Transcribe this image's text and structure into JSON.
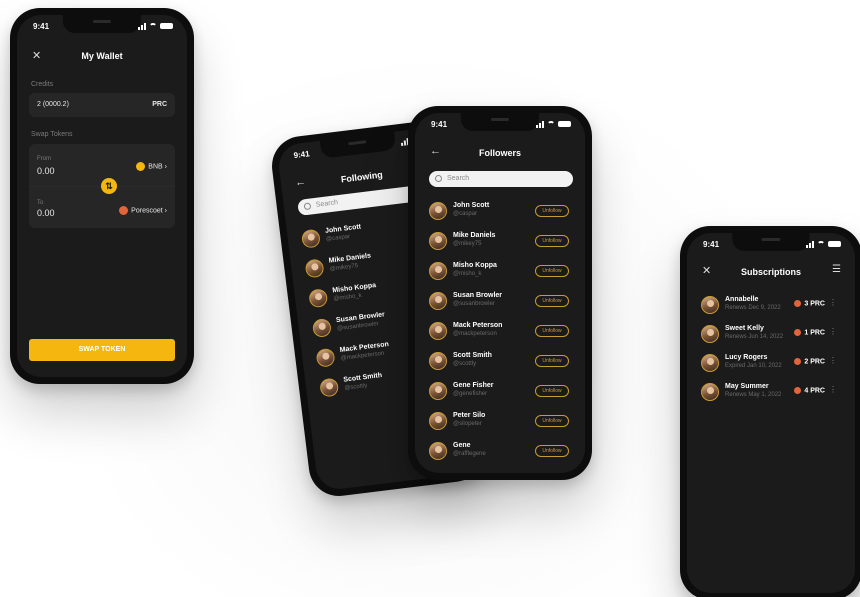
{
  "status_time": "9:41",
  "wallet": {
    "title": "My Wallet",
    "credits_label": "Credits",
    "credits_value": "2 (0000.2)",
    "credits_currency": "PRC",
    "swap_label": "Swap Tokens",
    "from_label": "From",
    "from_amount": "0.00",
    "from_token": "BNB",
    "to_label": "To",
    "to_amount": "0.00",
    "to_token": "Porescoet",
    "swap_button": "SWAP TOKEN"
  },
  "following": {
    "title": "Following",
    "search_placeholder": "Search",
    "items": [
      {
        "name": "John Scott",
        "handle": "@caspar"
      },
      {
        "name": "Mike Daniels",
        "handle": "@mikey75"
      },
      {
        "name": "Misho Koppa",
        "handle": "@misho_k"
      },
      {
        "name": "Susan Browler",
        "handle": "@susanbrowler"
      },
      {
        "name": "Mack Peterson",
        "handle": "@mackpeterson"
      },
      {
        "name": "Scott Smith",
        "handle": "@scottly"
      }
    ]
  },
  "followers": {
    "title": "Followers",
    "search_placeholder": "Search",
    "unfollow_label": "Unfollow",
    "items": [
      {
        "name": "John Scott",
        "handle": "@caspar"
      },
      {
        "name": "Mike Daniels",
        "handle": "@mikey75"
      },
      {
        "name": "Misho Koppa",
        "handle": "@misho_k"
      },
      {
        "name": "Susan Browler",
        "handle": "@susanbrowler"
      },
      {
        "name": "Mack Peterson",
        "handle": "@mackpeterson"
      },
      {
        "name": "Scott Smith",
        "handle": "@scottly"
      },
      {
        "name": "Gene Fisher",
        "handle": "@genefisher"
      },
      {
        "name": "Peter Silo",
        "handle": "@silopeter"
      },
      {
        "name": "Gene",
        "handle": "@rafflegene"
      }
    ]
  },
  "subscriptions": {
    "title": "Subscriptions",
    "items": [
      {
        "name": "Annabelle",
        "note": "Renews Dec 9, 2022",
        "amount": "3 PRC",
        "expired": false
      },
      {
        "name": "Sweet Kelly",
        "note": "Renews Jun 14, 2022",
        "amount": "1 PRC",
        "expired": false
      },
      {
        "name": "Lucy Rogers",
        "note": "Expired Jan 10, 2022",
        "amount": "2 PRC",
        "expired": true
      },
      {
        "name": "May Summer",
        "note": "Renews May 1, 2022",
        "amount": "4 PRC",
        "expired": false
      }
    ]
  },
  "colors": {
    "accent": "#f5b70f",
    "screen_bg": "#1b1b1b",
    "frame": "#0d0d0d"
  }
}
